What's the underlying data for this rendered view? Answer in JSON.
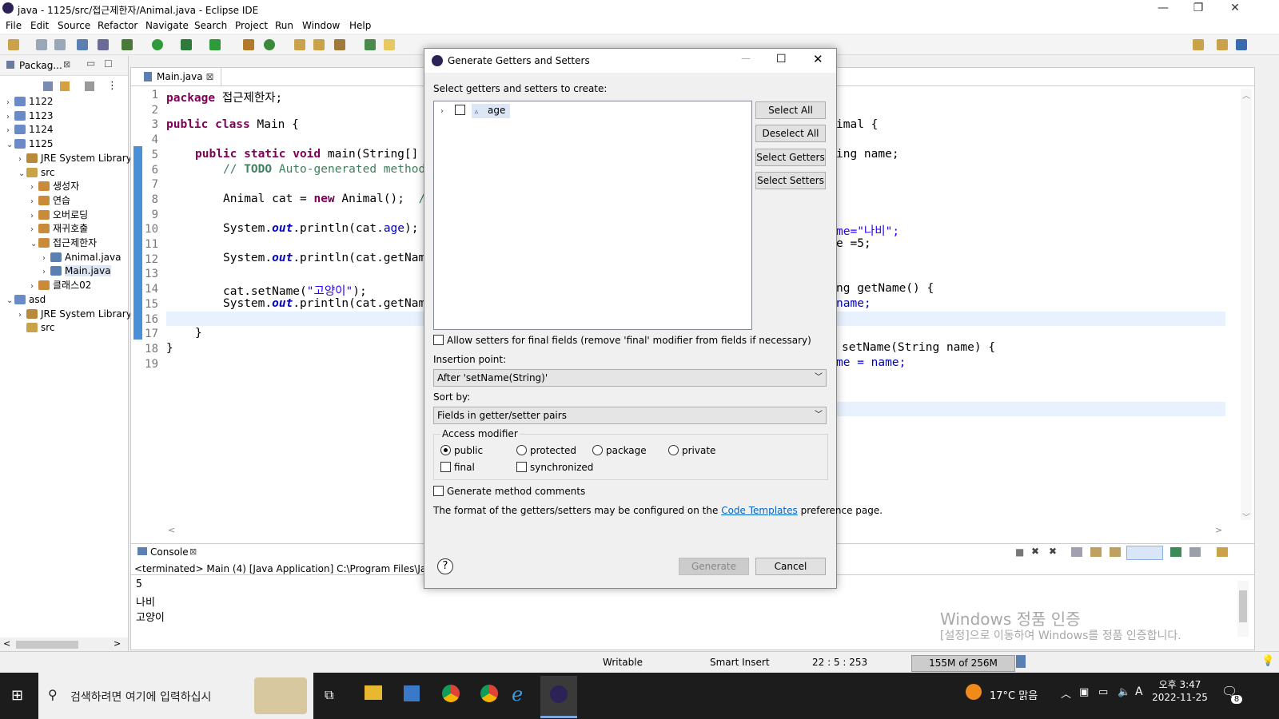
{
  "window": {
    "title": "java - 1125/src/접근제한자/Animal.java - Eclipse IDE"
  },
  "menu": [
    "File",
    "Edit",
    "Source",
    "Refactor",
    "Navigate",
    "Search",
    "Project",
    "Run",
    "Window",
    "Help"
  ],
  "explorer": {
    "tab": "Packag...",
    "items": [
      {
        "label": "1122",
        "indent": 0,
        "icon": "project"
      },
      {
        "label": "1123",
        "indent": 0,
        "icon": "project"
      },
      {
        "label": "1124",
        "indent": 0,
        "icon": "project"
      },
      {
        "label": "1125",
        "indent": 0,
        "icon": "project"
      },
      {
        "label": "JRE System Library",
        "indent": 1,
        "icon": "library"
      },
      {
        "label": "src",
        "indent": 1,
        "icon": "src"
      },
      {
        "label": "생성자",
        "indent": 2,
        "icon": "package"
      },
      {
        "label": "연습",
        "indent": 2,
        "icon": "package"
      },
      {
        "label": "오버로딩",
        "indent": 2,
        "icon": "package"
      },
      {
        "label": "재귀호출",
        "indent": 2,
        "icon": "package"
      },
      {
        "label": "접근제한자",
        "indent": 2,
        "icon": "package"
      },
      {
        "label": "Animal.java",
        "indent": 3,
        "icon": "java"
      },
      {
        "label": "Main.java",
        "indent": 3,
        "icon": "java"
      },
      {
        "label": "클래스02",
        "indent": 2,
        "icon": "package"
      },
      {
        "label": "asd",
        "indent": 0,
        "icon": "project"
      },
      {
        "label": "JRE System Library",
        "indent": 1,
        "icon": "library"
      },
      {
        "label": "src",
        "indent": 1,
        "icon": "src"
      }
    ]
  },
  "editor": {
    "tab": "Main.java",
    "line_numbers": [
      "1",
      "2",
      "3",
      "4",
      "5",
      "6",
      "7",
      "8",
      "9",
      "10",
      "11",
      "12",
      "13",
      "14",
      "15",
      "16",
      "17",
      "18",
      "19"
    ],
    "right_fragments": [
      "imal {",
      "ing name;",
      "me=\"나비\";",
      "e =5;",
      "ng getName() {",
      "name;",
      "setName(String name) {",
      "me = name;"
    ]
  },
  "console": {
    "tab": "Console",
    "header": "<terminated> Main (4) [Java Application] C:\\Program Files\\Java\\jre",
    "lines": [
      "5",
      "나비",
      "고양이"
    ]
  },
  "status": {
    "writable": "Writable",
    "insert": "Smart Insert",
    "position": "22 : 5 : 253",
    "memory": "155M of 256M"
  },
  "watermark": {
    "line1": "Windows 정품 인증",
    "line2": "[설정]으로 이동하여 Windows를 정품 인증합니다."
  },
  "taskbar": {
    "search": "검색하려면 여기에 입력하십시",
    "weather": "17°C 맑음",
    "time": "오후 3:47",
    "date": "2022-11-25",
    "notif": "8"
  },
  "dialog": {
    "title": "Generate Getters and Setters",
    "prompt": "Select getters and setters to create:",
    "field": "age",
    "buttons": {
      "select_all": "Select All",
      "deselect_all": "Deselect All",
      "select_getters": "Select Getters",
      "select_setters": "Select Setters",
      "generate": "Generate",
      "cancel": "Cancel"
    },
    "allow_final": "Allow setters for final fields (remove 'final' modifier from fields if necessary)",
    "insertion_label": "Insertion point:",
    "insertion_value": "After 'setName(String)'",
    "sort_label": "Sort by:",
    "sort_value": "Fields in getter/setter pairs",
    "access_label": "Access modifier",
    "access": {
      "public": "public",
      "protected": "protected",
      "package": "package",
      "private": "private",
      "final": "final",
      "synchronized": "synchronized"
    },
    "gen_comments": "Generate method comments",
    "footer_pre": "The format of the getters/setters may be configured on the",
    "footer_link": "Code Templates",
    "footer_post": "preference page."
  }
}
